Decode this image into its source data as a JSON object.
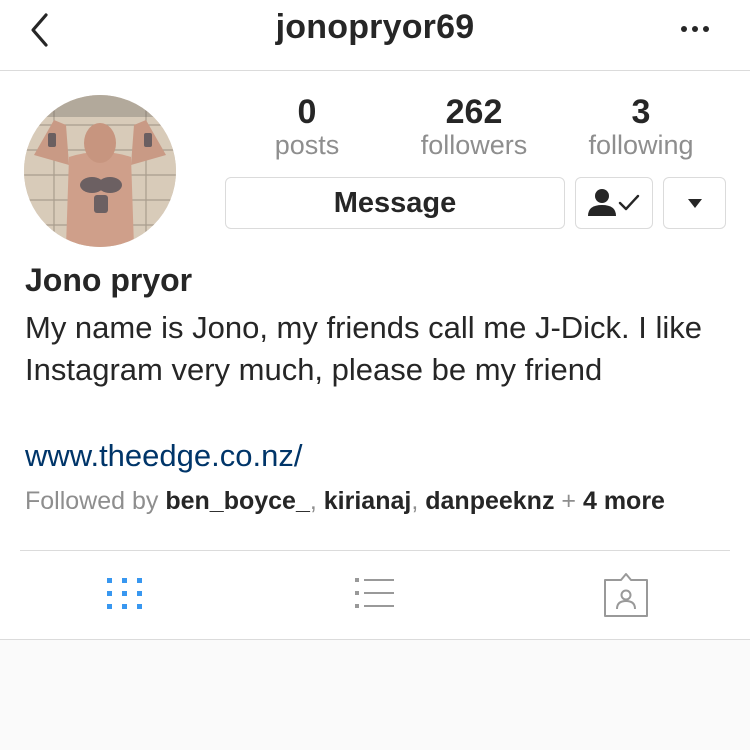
{
  "header": {
    "username": "jonopryor69",
    "back_icon": "chevron-left-icon",
    "more_icon": "more-horizontal-icon"
  },
  "stats": [
    {
      "value": "0",
      "label": "posts"
    },
    {
      "value": "262",
      "label": "followers"
    },
    {
      "value": "3",
      "label": "following"
    }
  ],
  "actions": {
    "message_label": "Message",
    "following_icon": "person-check-icon",
    "dropdown_icon": "caret-down-icon"
  },
  "profile": {
    "name": "Jono pryor",
    "bio": "My name is Jono, my friends call me J-Dick. I like Instagram very much, please be my friend",
    "website": "www.theedge.co.nz/"
  },
  "followed_by": {
    "prefix": "Followed by",
    "users": [
      "ben_boyce_",
      "kirianaj",
      "danpeeknz"
    ],
    "sep": ",",
    "plus": "+",
    "more": "4 more"
  },
  "tabs": [
    {
      "icon": "grid-icon",
      "active": true
    },
    {
      "icon": "list-icon",
      "active": false
    },
    {
      "icon": "tagged-icon",
      "active": false
    }
  ],
  "colors": {
    "active_tab": "#3897f0",
    "inactive_tab": "#999999",
    "link": "#003569"
  }
}
